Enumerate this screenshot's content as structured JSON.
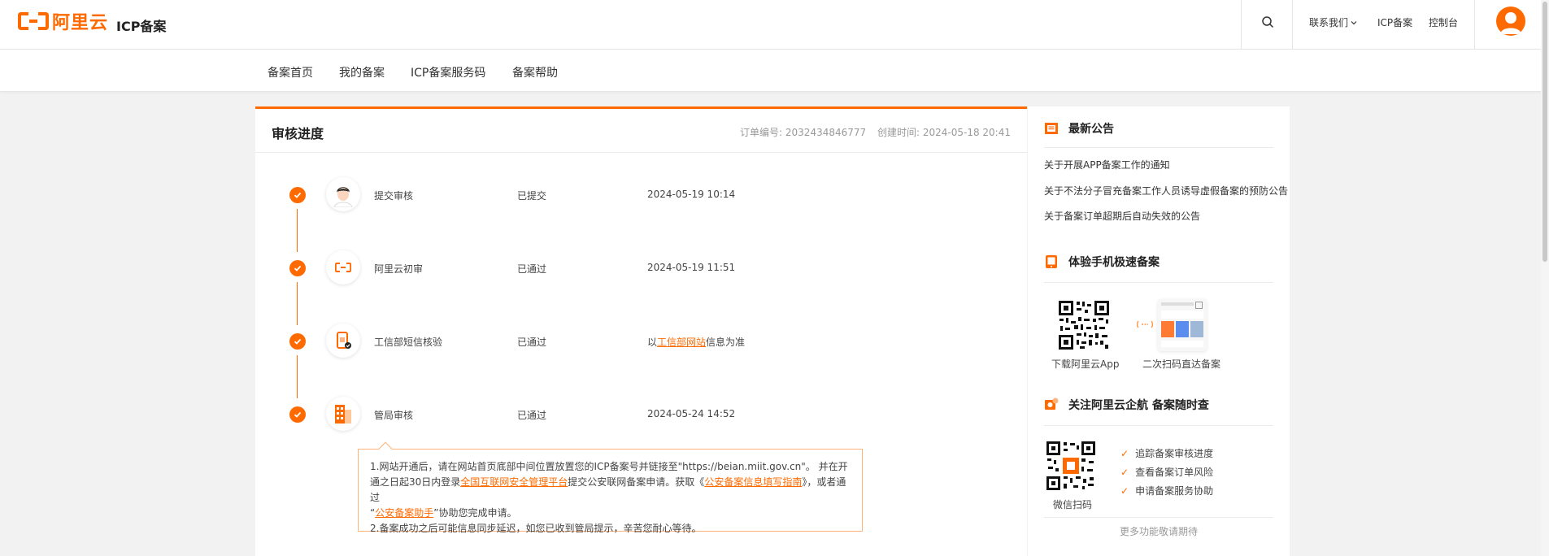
{
  "header": {
    "logo_text": "阿里云",
    "site_title": "ICP备案",
    "links": [
      "联系我们",
      "ICP备案",
      "控制台"
    ]
  },
  "subnav": {
    "items": [
      "备案首页",
      "我的备案",
      "ICP备案服务码",
      "备案帮助"
    ]
  },
  "main": {
    "title": "审核进度",
    "order_no": "订单编号: 2032434846777",
    "created": "创建时间: 2024-05-18 20:41",
    "steps": [
      {
        "name": "提交审核",
        "status": "已提交",
        "time": "2024-05-19 10:14",
        "icon": "person-avatar-icon"
      },
      {
        "name": "阿里云初审",
        "status": "已通过",
        "time": "2024-05-19 11:51",
        "icon": "aliyun-logo-icon"
      },
      {
        "name": "工信部短信核验",
        "status": "已通过",
        "time_prefix": "以",
        "time_link": "工信部网站",
        "time_suffix": "信息为准",
        "icon": "phone-verify-icon"
      },
      {
        "name": "管局审核",
        "status": "已通过",
        "time": "2024-05-24 14:52",
        "icon": "building-icon"
      }
    ],
    "tip": {
      "l1a": "1.网站开通后，请在网站首页底部中间位置放置您的ICP备案号并链接至\"https://beian.miit.gov.cn\"。 并在开通之日起30日内登录",
      "l1_link1": "全国互联网安全管理平台",
      "l1b": "提交公安联网备案申请。获取《",
      "l1_link2": "公安备案信息填写指南",
      "l1c": "》，或者通过",
      "l1d": "“",
      "l1_link3": "公安备案助手",
      "l1e": "”协助您完成申请。",
      "l2": "2.备案成功之后可能信息同步延迟，如您已收到管局提示，辛苦您耐心等待。"
    }
  },
  "sidebar": {
    "notice_title": "最新公告",
    "notices": [
      "关于开展APP备案工作的通知",
      "关于不法分子冒充备案工作人员诱导虚假备案的预防公告",
      "关于备案订单超期后自动失效的公告"
    ],
    "mobile_title": "体验手机极速备案",
    "qr_app_label": "下载阿里云App",
    "qr_scan_label": "二次扫码直达备案",
    "wechat_title": "关注阿里云企航 备案随时查",
    "wechat_label": "微信扫码",
    "checks": [
      "追踪备案审核进度",
      "查看备案订单风险",
      "申请备案服务协助"
    ],
    "more": "更多功能敬请期待"
  },
  "colors": {
    "accent": "#ff6a00"
  }
}
